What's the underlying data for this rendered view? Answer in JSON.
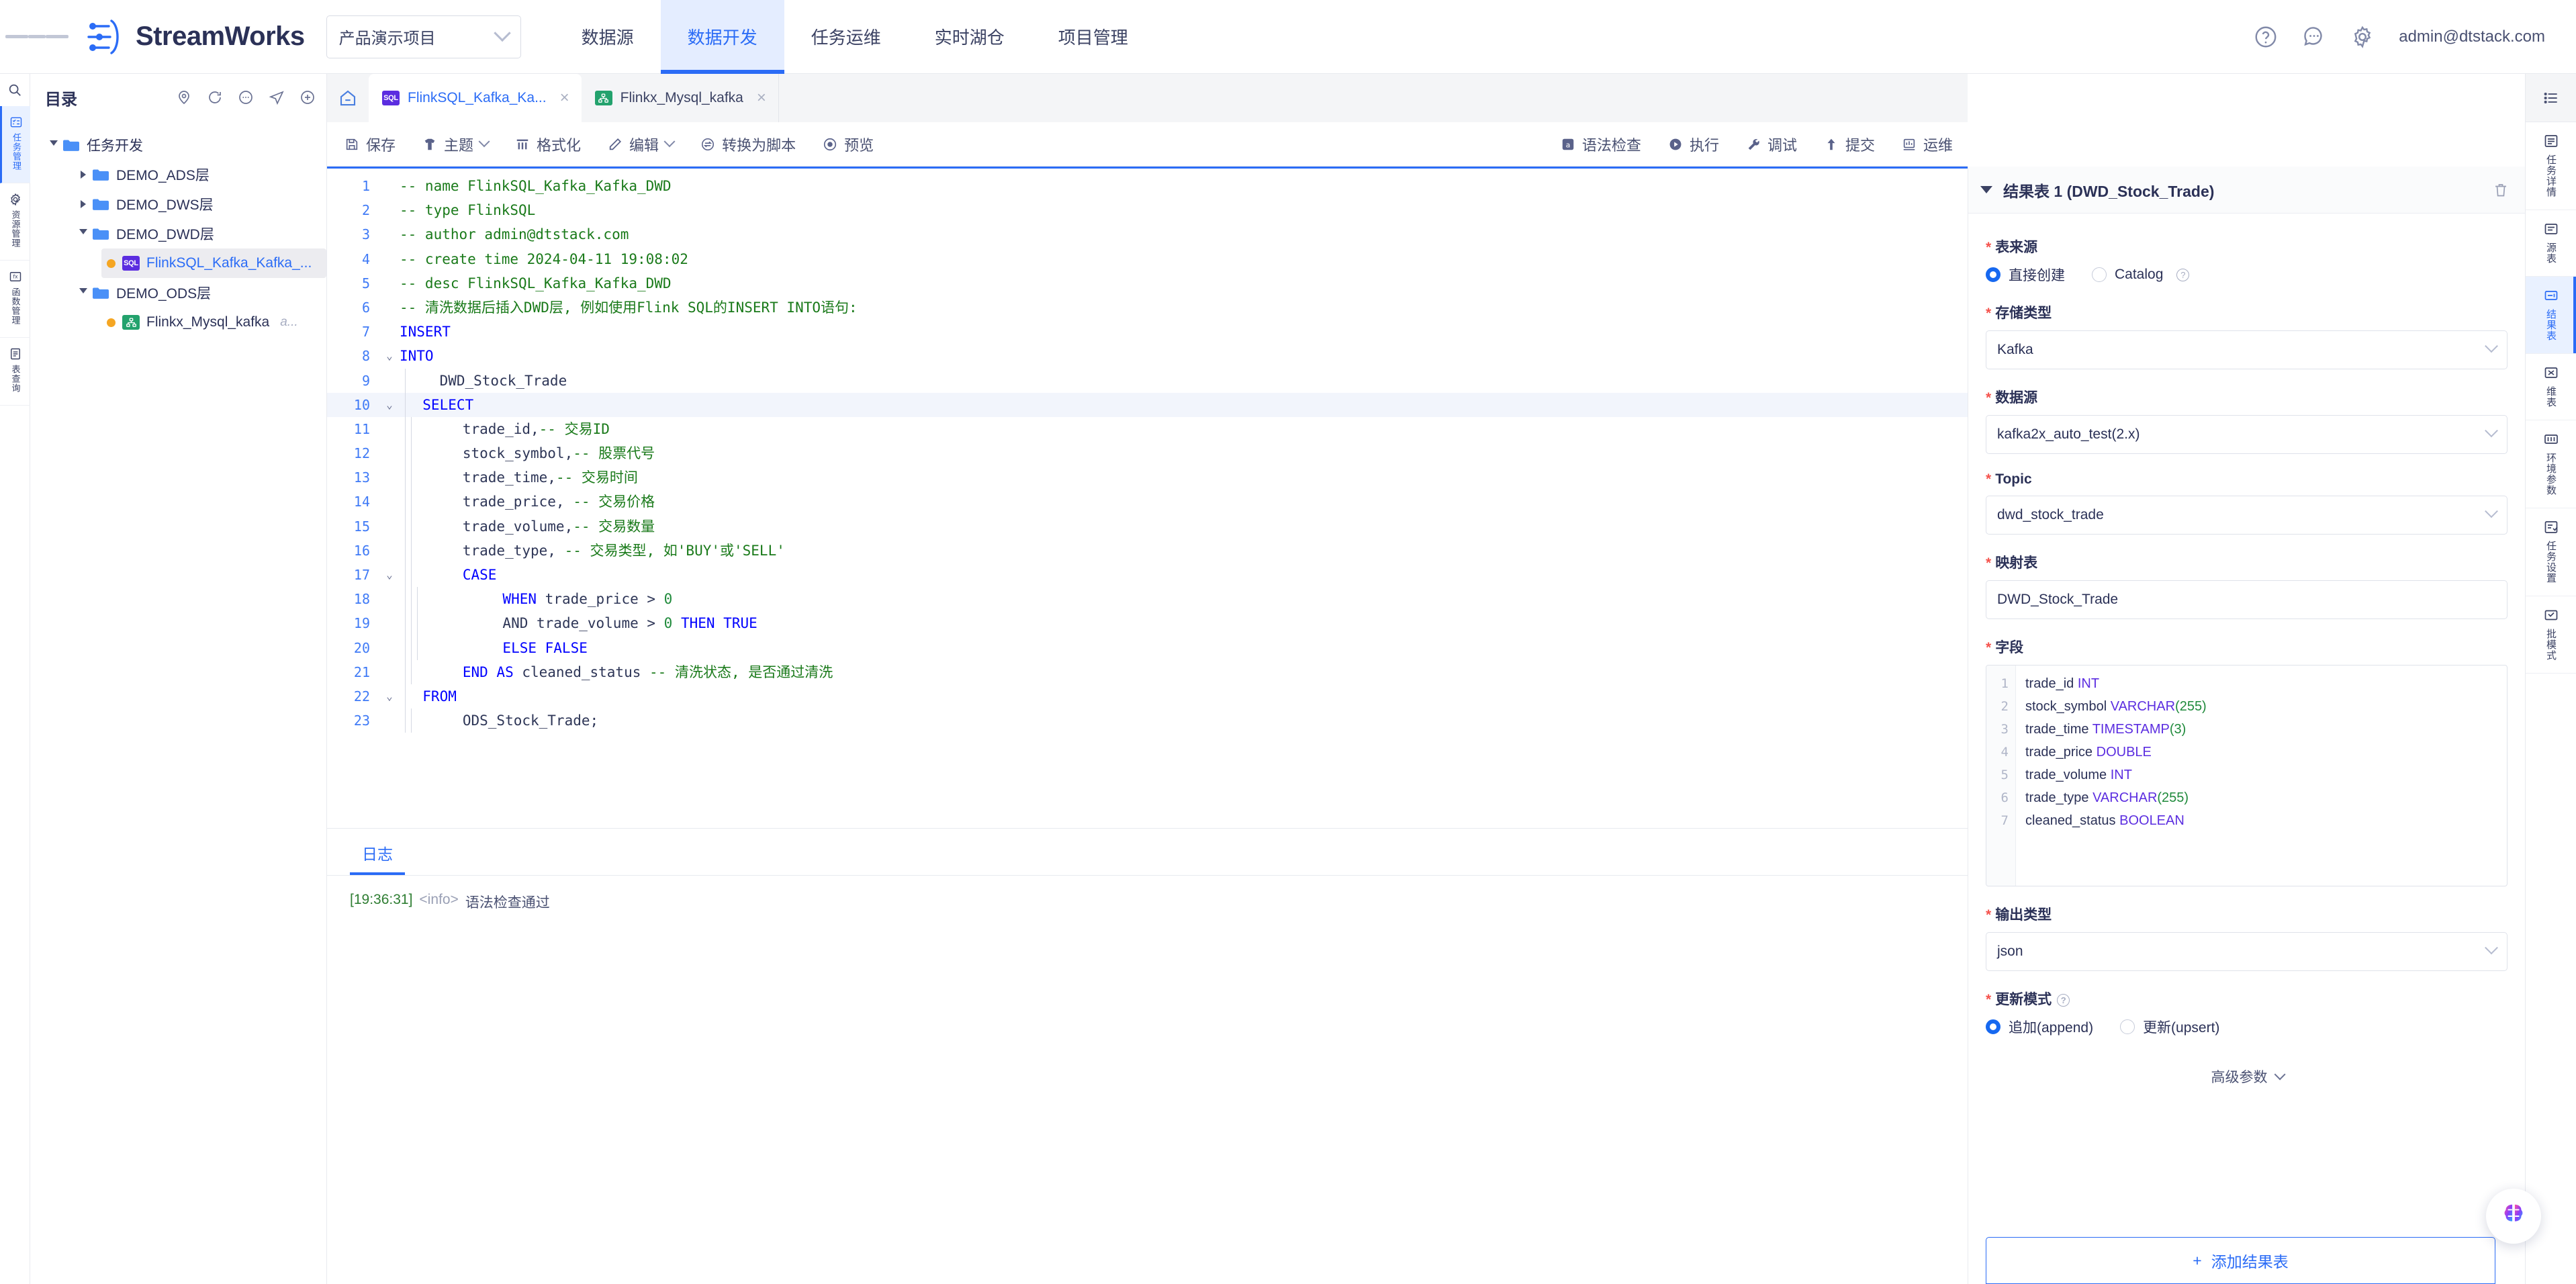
{
  "header": {
    "brand": "StreamWorks",
    "project_select": "产品演示项目",
    "nav": [
      {
        "label": "数据源",
        "active": false
      },
      {
        "label": "数据开发",
        "active": true
      },
      {
        "label": "任务运维",
        "active": false
      },
      {
        "label": "实时湖仓",
        "active": false
      },
      {
        "label": "项目管理",
        "active": false
      }
    ],
    "icons": [
      "help-icon",
      "message-icon",
      "gear-icon"
    ],
    "user": "admin@dtstack.com"
  },
  "left_rail": {
    "search_icon": "search-icon",
    "items": [
      {
        "label": "任务管理",
        "icon": "task-list-icon",
        "active": true
      },
      {
        "label": "资源管理",
        "icon": "gear-icon",
        "active": false
      },
      {
        "label": "函数管理",
        "icon": "fx-icon",
        "active": false
      },
      {
        "label": "表查询",
        "icon": "table-icon",
        "active": false
      }
    ]
  },
  "directory": {
    "title": "目录",
    "tools": [
      "location-icon",
      "refresh-icon",
      "more-icon",
      "send-icon",
      "plus-icon"
    ],
    "tree": [
      {
        "label": "任务开发",
        "depth": 0,
        "type": "folder",
        "expanded": true
      },
      {
        "label": "DEMO_ADS层",
        "depth": 1,
        "type": "folder",
        "expanded": false
      },
      {
        "label": "DEMO_DWS层",
        "depth": 1,
        "type": "folder",
        "expanded": false
      },
      {
        "label": "DEMO_DWD层",
        "depth": 1,
        "type": "folder",
        "expanded": true
      },
      {
        "label": "FlinkSQL_Kafka_Kafka_...",
        "depth": 2,
        "type": "sql",
        "selected": true,
        "suffix": ""
      },
      {
        "label": "DEMO_ODS层",
        "depth": 1,
        "type": "folder",
        "expanded": true
      },
      {
        "label": "Flinkx_Mysql_kafka",
        "depth": 2,
        "type": "flinkx",
        "selected": false,
        "suffix": "a..."
      }
    ]
  },
  "editor_tabs": {
    "home_icon": "home-icon",
    "tabs": [
      {
        "label": "FlinkSQL_Kafka_Ka...",
        "icon": "sql-badge",
        "active": true
      },
      {
        "label": "Flinkx_Mysql_kafka",
        "icon": "flinkx-badge",
        "active": false
      }
    ],
    "menu_icon": "tab-menu-icon"
  },
  "toolbar": {
    "left": [
      {
        "label": "保存",
        "icon": "save-icon",
        "caret": false
      },
      {
        "label": "主题",
        "icon": "theme-icon",
        "caret": true
      },
      {
        "label": "格式化",
        "icon": "format-icon",
        "caret": false
      },
      {
        "label": "编辑",
        "icon": "pencil-icon",
        "caret": true
      },
      {
        "label": "转换为脚本",
        "icon": "convert-icon",
        "caret": false
      },
      {
        "label": "预览",
        "icon": "preview-icon",
        "caret": false
      }
    ],
    "right": [
      {
        "label": "语法检查",
        "icon": "syntax-check-icon"
      },
      {
        "label": "执行",
        "icon": "play-icon"
      },
      {
        "label": "调试",
        "icon": "wrench-icon"
      },
      {
        "label": "提交",
        "icon": "upload-icon"
      },
      {
        "label": "运维",
        "icon": "ops-icon"
      }
    ]
  },
  "code": {
    "lines": [
      {
        "n": 1,
        "fold": "",
        "indent": 0,
        "tokens": [
          {
            "t": "-- name FlinkSQL_Kafka_Kafka_DWD",
            "c": "cm"
          }
        ]
      },
      {
        "n": 2,
        "fold": "",
        "indent": 0,
        "tokens": [
          {
            "t": "-- type FlinkSQL",
            "c": "cm"
          }
        ]
      },
      {
        "n": 3,
        "fold": "",
        "indent": 0,
        "tokens": [
          {
            "t": "-- author admin@dtstack.com",
            "c": "cm"
          }
        ]
      },
      {
        "n": 4,
        "fold": "",
        "indent": 0,
        "tokens": [
          {
            "t": "-- create time 2024-04-11 19:08:02",
            "c": "cm"
          }
        ]
      },
      {
        "n": 5,
        "fold": "",
        "indent": 0,
        "tokens": [
          {
            "t": "-- desc FlinkSQL_Kafka_Kafka_DWD",
            "c": "cm"
          }
        ]
      },
      {
        "n": 6,
        "fold": "",
        "indent": 0,
        "tokens": [
          {
            "t": "-- 清洗数据后插入DWD层, 例如使用Flink SQL的INSERT INTO语句:",
            "c": "cm"
          }
        ]
      },
      {
        "n": 7,
        "fold": "",
        "indent": 0,
        "tokens": [
          {
            "t": "INSERT",
            "c": "ck"
          }
        ]
      },
      {
        "n": 8,
        "fold": "v",
        "indent": 0,
        "tokens": [
          {
            "t": "INTO",
            "c": "ck"
          }
        ]
      },
      {
        "n": 9,
        "fold": "",
        "indent": 1,
        "tokens": [
          {
            "t": "    DWD_Stock_Trade",
            "c": "cp"
          }
        ]
      },
      {
        "n": 10,
        "fold": "v",
        "indent": 1,
        "hl": true,
        "tokens": [
          {
            "t": "  SELECT",
            "c": "ck"
          }
        ]
      },
      {
        "n": 11,
        "fold": "",
        "indent": 2,
        "tokens": [
          {
            "t": "      trade_id,",
            "c": "cp"
          },
          {
            "t": "-- 交易ID",
            "c": "cm"
          }
        ]
      },
      {
        "n": 12,
        "fold": "",
        "indent": 2,
        "tokens": [
          {
            "t": "      stock_symbol,",
            "c": "cp"
          },
          {
            "t": "-- 股票代号",
            "c": "cm"
          }
        ]
      },
      {
        "n": 13,
        "fold": "",
        "indent": 2,
        "tokens": [
          {
            "t": "      trade_time,",
            "c": "cp"
          },
          {
            "t": "-- 交易时间",
            "c": "cm"
          }
        ]
      },
      {
        "n": 14,
        "fold": "",
        "indent": 2,
        "tokens": [
          {
            "t": "      trade_price, ",
            "c": "cp"
          },
          {
            "t": "-- 交易价格",
            "c": "cm"
          }
        ]
      },
      {
        "n": 15,
        "fold": "",
        "indent": 2,
        "tokens": [
          {
            "t": "      trade_volume,",
            "c": "cp"
          },
          {
            "t": "-- 交易数量",
            "c": "cm"
          }
        ]
      },
      {
        "n": 16,
        "fold": "",
        "indent": 2,
        "tokens": [
          {
            "t": "      trade_type, ",
            "c": "cp"
          },
          {
            "t": "-- 交易类型, 如'BUY'或'SELL'",
            "c": "cm"
          }
        ]
      },
      {
        "n": 17,
        "fold": "v",
        "indent": 2,
        "tokens": [
          {
            "t": "      CASE",
            "c": "ck"
          }
        ]
      },
      {
        "n": 18,
        "fold": "",
        "indent": 3,
        "tokens": [
          {
            "t": "          WHEN",
            "c": "ck"
          },
          {
            "t": " trade_price > ",
            "c": "cp"
          },
          {
            "t": "0",
            "c": "cn"
          }
        ]
      },
      {
        "n": 19,
        "fold": "",
        "indent": 3,
        "tokens": [
          {
            "t": "          AND",
            "c": "cp"
          },
          {
            "t": " trade_volume > ",
            "c": "cp"
          },
          {
            "t": "0",
            "c": "cn"
          },
          {
            "t": " THEN TRUE",
            "c": "ck"
          }
        ]
      },
      {
        "n": 20,
        "fold": "",
        "indent": 3,
        "tokens": [
          {
            "t": "          ELSE FALSE",
            "c": "ck"
          }
        ]
      },
      {
        "n": 21,
        "fold": "",
        "indent": 2,
        "tokens": [
          {
            "t": "      END AS",
            "c": "ck"
          },
          {
            "t": " cleaned_status ",
            "c": "cp"
          },
          {
            "t": "-- 清洗状态, 是否通过清洗",
            "c": "cm"
          }
        ]
      },
      {
        "n": 22,
        "fold": "v",
        "indent": 1,
        "tokens": [
          {
            "t": "  FROM",
            "c": "ck"
          }
        ]
      },
      {
        "n": 23,
        "fold": "",
        "indent": 2,
        "tokens": [
          {
            "t": "      ODS_Stock_Trade;",
            "c": "cp"
          }
        ]
      }
    ]
  },
  "log": {
    "tab": "日志",
    "entries": [
      {
        "time": "[19:36:31]",
        "level": "<info>",
        "message": "语法检查通过"
      }
    ]
  },
  "config_panel": {
    "title": "结果表 1 (DWD_Stock_Trade)",
    "delete_icon": "trash-icon",
    "table_source": {
      "label": "表来源",
      "options": [
        {
          "label": "直接创建",
          "selected": true
        },
        {
          "label": "Catalog",
          "selected": false,
          "help": true
        }
      ]
    },
    "storage_type": {
      "label": "存储类型",
      "value": "Kafka"
    },
    "datasource": {
      "label": "数据源",
      "value": "kafka2x_auto_test(2.x)"
    },
    "topic": {
      "label": "Topic",
      "value": "dwd_stock_trade"
    },
    "mapping_table": {
      "label": "映射表",
      "value": "DWD_Stock_Trade"
    },
    "fields": {
      "label": "字段",
      "rows": [
        {
          "n": 1,
          "name": "trade_id",
          "type": "INT",
          "size": ""
        },
        {
          "n": 2,
          "name": "stock_symbol",
          "type": "VARCHAR",
          "size": "(255)"
        },
        {
          "n": 3,
          "name": "trade_time",
          "type": "TIMESTAMP",
          "size": "(3)"
        },
        {
          "n": 4,
          "name": "trade_price",
          "type": "DOUBLE",
          "size": ""
        },
        {
          "n": 5,
          "name": "trade_volume",
          "type": "INT",
          "size": ""
        },
        {
          "n": 6,
          "name": "trade_type",
          "type": "VARCHAR",
          "size": "(255)"
        },
        {
          "n": 7,
          "name": "cleaned_status",
          "type": "BOOLEAN",
          "size": ""
        }
      ]
    },
    "output_type": {
      "label": "输出类型",
      "value": "json"
    },
    "update_mode": {
      "label": "更新模式",
      "help": true,
      "options": [
        {
          "label": "追加(append)",
          "selected": true
        },
        {
          "label": "更新(upsert)",
          "selected": false
        }
      ]
    },
    "advanced": "高级参数",
    "add_button": "添加结果表"
  },
  "right_rail": {
    "items": [
      {
        "label": "任务详情",
        "icon": "task-detail-icon",
        "active": false
      },
      {
        "label": "源表",
        "icon": "source-table-icon",
        "active": false
      },
      {
        "label": "结果表",
        "icon": "result-table-icon",
        "active": true
      },
      {
        "label": "维表",
        "icon": "dim-table-icon",
        "active": false
      },
      {
        "label": "环境参数",
        "icon": "env-param-icon",
        "active": false
      },
      {
        "label": "任务设置",
        "icon": "task-setting-icon",
        "active": false
      },
      {
        "label": "批模式",
        "icon": "batch-mode-icon",
        "active": false
      }
    ]
  },
  "ai_assistant": {
    "icon": "ai-brain-icon"
  }
}
